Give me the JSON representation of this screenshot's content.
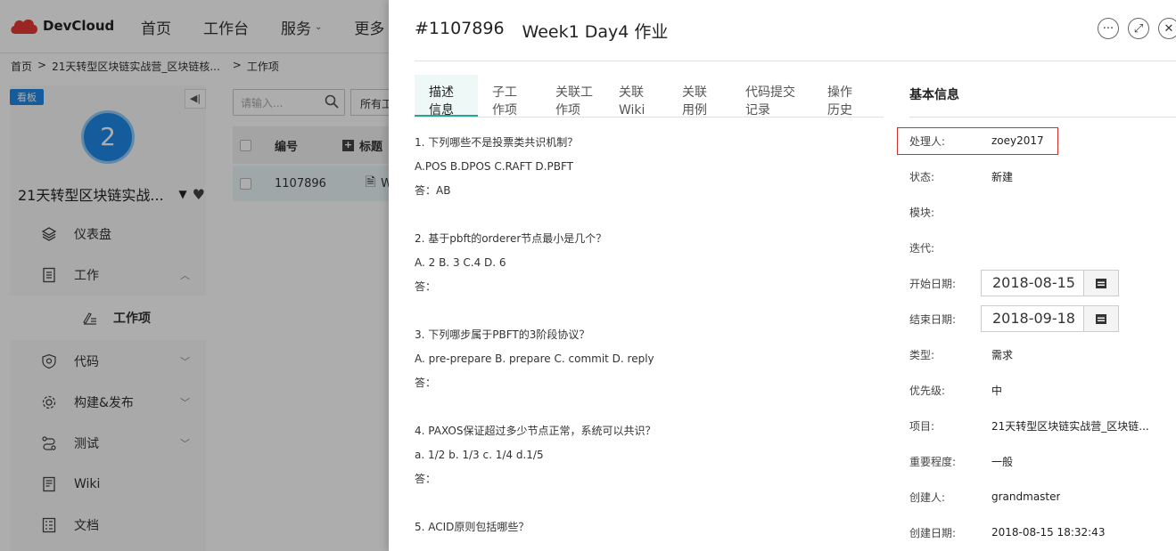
{
  "app": {
    "logo_text": "DevCloud",
    "top_nav": [
      "首页",
      "工作台",
      "服务",
      "更多"
    ],
    "breadcrumb": [
      "首页",
      ">",
      "21天转型区块链实战营_区块链核...",
      ">",
      "工作项"
    ]
  },
  "sidebar": {
    "board_tag": "看板",
    "project_number": "2",
    "project_name": "21天转型区块链实战...",
    "items": [
      {
        "label": "仪表盘",
        "icon": "layers-icon"
      },
      {
        "label": "工作",
        "icon": "document-icon"
      },
      {
        "label": "工作项",
        "icon": "edit-list-icon"
      },
      {
        "label": "代码",
        "icon": "code-shield-icon"
      },
      {
        "label": "构建&发布",
        "icon": "gear-icon"
      },
      {
        "label": "测试",
        "icon": "flow-icon"
      },
      {
        "label": "Wiki",
        "icon": "wiki-icon"
      },
      {
        "label": "文档",
        "icon": "doc-list-icon"
      }
    ]
  },
  "list": {
    "search_placeholder": "请输入...",
    "filter_label": "所有工",
    "col_id": "编号",
    "col_title": "标题",
    "row_id": "1107896",
    "row_title": "W"
  },
  "drawer": {
    "id": "#1107896",
    "title": "Week1 Day4 作业",
    "tabs": [
      "描述\n信息",
      "子工\n作项",
      "关联工\n作项",
      "关联\nWiki",
      "关联\n用例",
      "代码提交\n记录",
      "操作\n历史"
    ],
    "questions": [
      {
        "q": "1. 下列哪些不是投票类共识机制？",
        "opts": "A.POS B.DPOS C.RAFT D.PBFT",
        "ans": "答：AB"
      },
      {
        "q": "2. 基于pbft的orderer节点最小是几个？",
        "opts": "A. 2  B. 3 C.4  D. 6",
        "ans": "答："
      },
      {
        "q": "3. 下列哪步属于PBFT的3阶段协议？",
        "opts": "A.  pre-prepare B. prepare C. commit D. reply",
        "ans": "答："
      },
      {
        "q": "4. PAXOS保证超过多少节点正常，系统可以共识？",
        "opts": "a. 1/2 b. 1/3 c. 1/4 d.1/5",
        "ans": "答："
      },
      {
        "q": "5. ACID原则包括哪些？",
        "opts": "",
        "ans": ""
      }
    ],
    "info_title": "基本信息",
    "info": {
      "assignee_label": "处理人:",
      "assignee": "zoey2017",
      "status_label": "状态:",
      "status": "新建",
      "module_label": "模块:",
      "module": "",
      "iteration_label": "迭代:",
      "iteration": "",
      "start_label": "开始日期:",
      "start": "2018-08-15",
      "end_label": "结束日期:",
      "end": "2018-09-18",
      "type_label": "类型:",
      "type": "需求",
      "priority_label": "优先级:",
      "priority": "中",
      "project_label": "项目:",
      "project": "21天转型区块链实战营_区块链...",
      "importance_label": "重要程度:",
      "importance": "一般",
      "creator_label": "创建人:",
      "creator": "grandmaster",
      "created_label": "创建日期:",
      "created": "2018-08-15 18:32:43"
    }
  }
}
